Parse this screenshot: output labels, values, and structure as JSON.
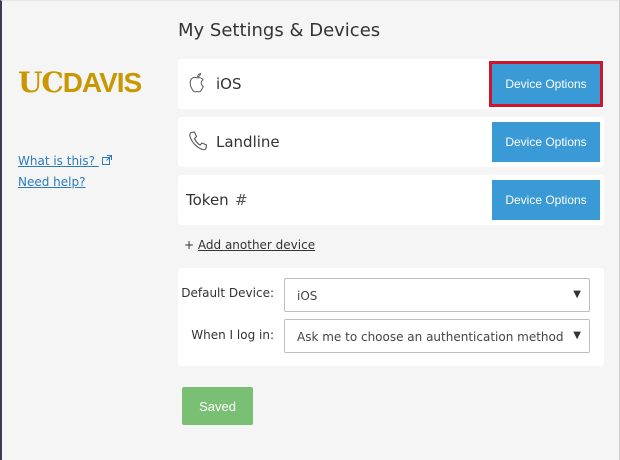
{
  "page": {
    "title": "My Settings & Devices"
  },
  "brand": {
    "uc": "UC",
    "davis": "DAVIS",
    "color": "#c99700"
  },
  "sidebar": {
    "what_is_this": "What is this?",
    "need_help": "Need help?"
  },
  "devices": [
    {
      "label": "iOS",
      "icon": "apple-icon",
      "button_label": "Device Options"
    },
    {
      "label": "Landline",
      "icon": "phone-icon",
      "button_label": "Device Options"
    },
    {
      "label": "Token",
      "icon": "hash-icon",
      "button_label": "Device Options"
    }
  ],
  "add_device": {
    "prefix": "+",
    "label": "Add another device"
  },
  "preferences": {
    "default_device": {
      "label": "Default Device:",
      "value": "iOS"
    },
    "when_login": {
      "label": "When I log in:",
      "value": "Ask me to choose an authentication method"
    }
  },
  "save_button": {
    "label": "Saved",
    "color": "#7ac074"
  },
  "accent_color": "#3a9ad5",
  "highlight_color": "#d0142c"
}
